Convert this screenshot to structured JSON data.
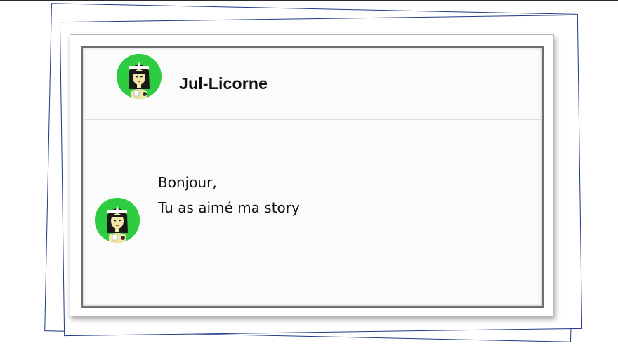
{
  "chat": {
    "username": "Jul-Licorne",
    "avatar_icon": "girl-avatar-icon",
    "avatar_color": "#2ecc40",
    "message_lines": [
      "Bonjour,",
      "Tu as aimé ma story"
    ]
  }
}
